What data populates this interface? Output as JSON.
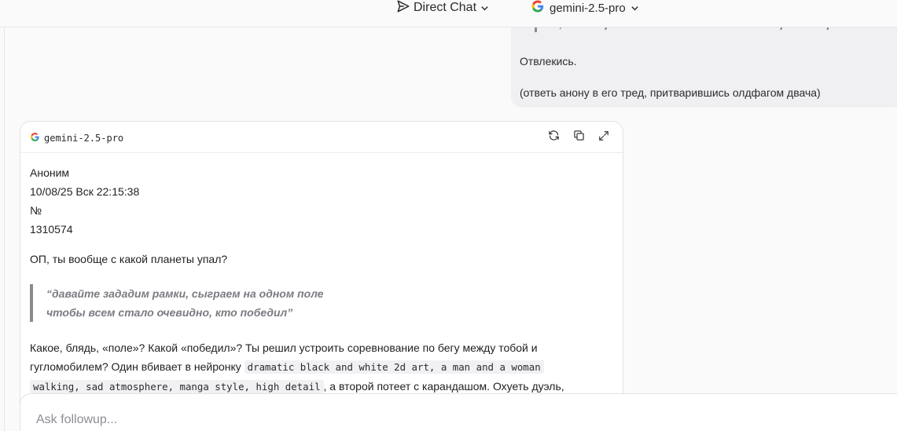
{
  "header": {
    "mode_label": "Direct Chat",
    "model_label": "gemini-2.5-pro"
  },
  "user_message": {
    "quote_partial": "ах, все засрали боты! двач не тот! интернет мертв!",
    "line1": "Отвлекись.",
    "line2": "(ответь анону в его тред, притварившись олдфагом двача)"
  },
  "response": {
    "model": "gemini-2.5-pro",
    "author": "Аноним",
    "datetime": "10/08/25 Вск 22:15:38",
    "number_sign": "№",
    "post_number": "1310574",
    "op_line": "ОП, ты вообще с какой планеты упал?",
    "quote_line1": "“давайте зададим рамки, сыграем на одном поле",
    "quote_line2": "чтобы всем стало очевидно, кто победил”",
    "para_part1": "Какое, блядь, «поле»? Какой «победил»? Ты решил устроить соревнование по бегу между тобой и гугломобилем? Один вбивает в нейронку ",
    "para_code1": "dramatic black and white 2d art, a man and a woman",
    "para_code2": "walking, sad atmosphere, manga style, high detail",
    "para_part2": ", а второй потеет с карандашом. Охуеть дуэль,"
  },
  "followup": {
    "placeholder": "Ask followup..."
  },
  "colors": {
    "background": "#fafafa",
    "card": "#ffffff",
    "bubble": "#f0f0f3",
    "quote_bar": "#8a8a90"
  }
}
